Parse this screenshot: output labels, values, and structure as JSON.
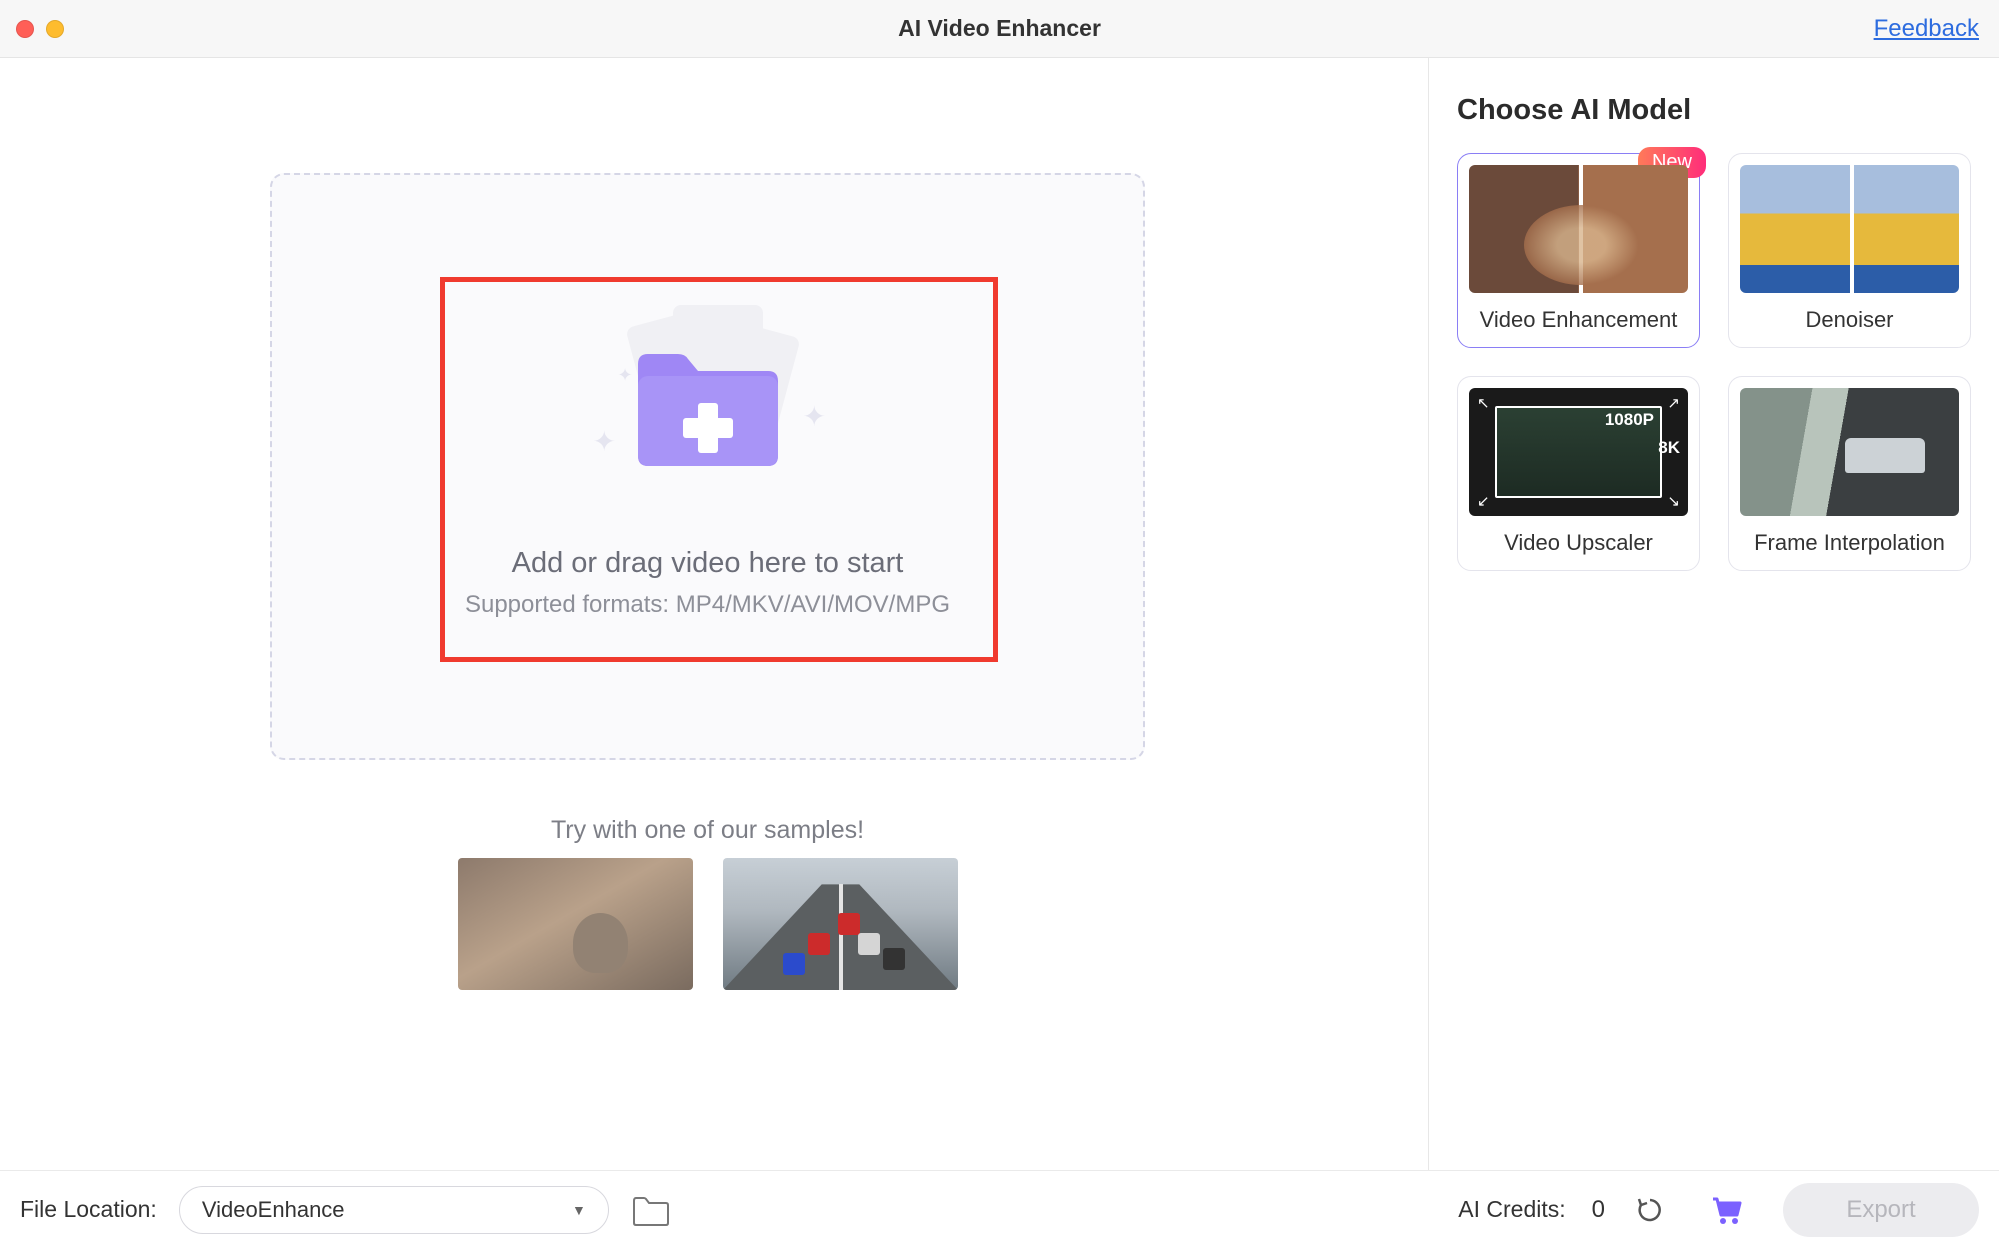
{
  "titlebar": {
    "app_title": "AI Video Enhancer",
    "feedback_label": "Feedback"
  },
  "dropzone": {
    "main_text": "Add or drag video here to start",
    "supported_text": "Supported formats: MP4/MKV/AVI/MOV/MPG"
  },
  "samples": {
    "label": "Try with one of our samples!"
  },
  "sidebar": {
    "title": "Choose AI Model",
    "models": [
      {
        "label": "Video Enhancement",
        "badge": "New",
        "selected": true
      },
      {
        "label": "Denoiser"
      },
      {
        "label": "Video Upscaler"
      },
      {
        "label": "Frame Interpolation"
      }
    ],
    "upscaler_badge_1080p": "1080P",
    "upscaler_badge_8k": "8K"
  },
  "bottombar": {
    "file_location_label": "File Location:",
    "file_location_value": "VideoEnhance",
    "credits_label": "AI Credits:",
    "credits_value": "0",
    "export_label": "Export"
  }
}
